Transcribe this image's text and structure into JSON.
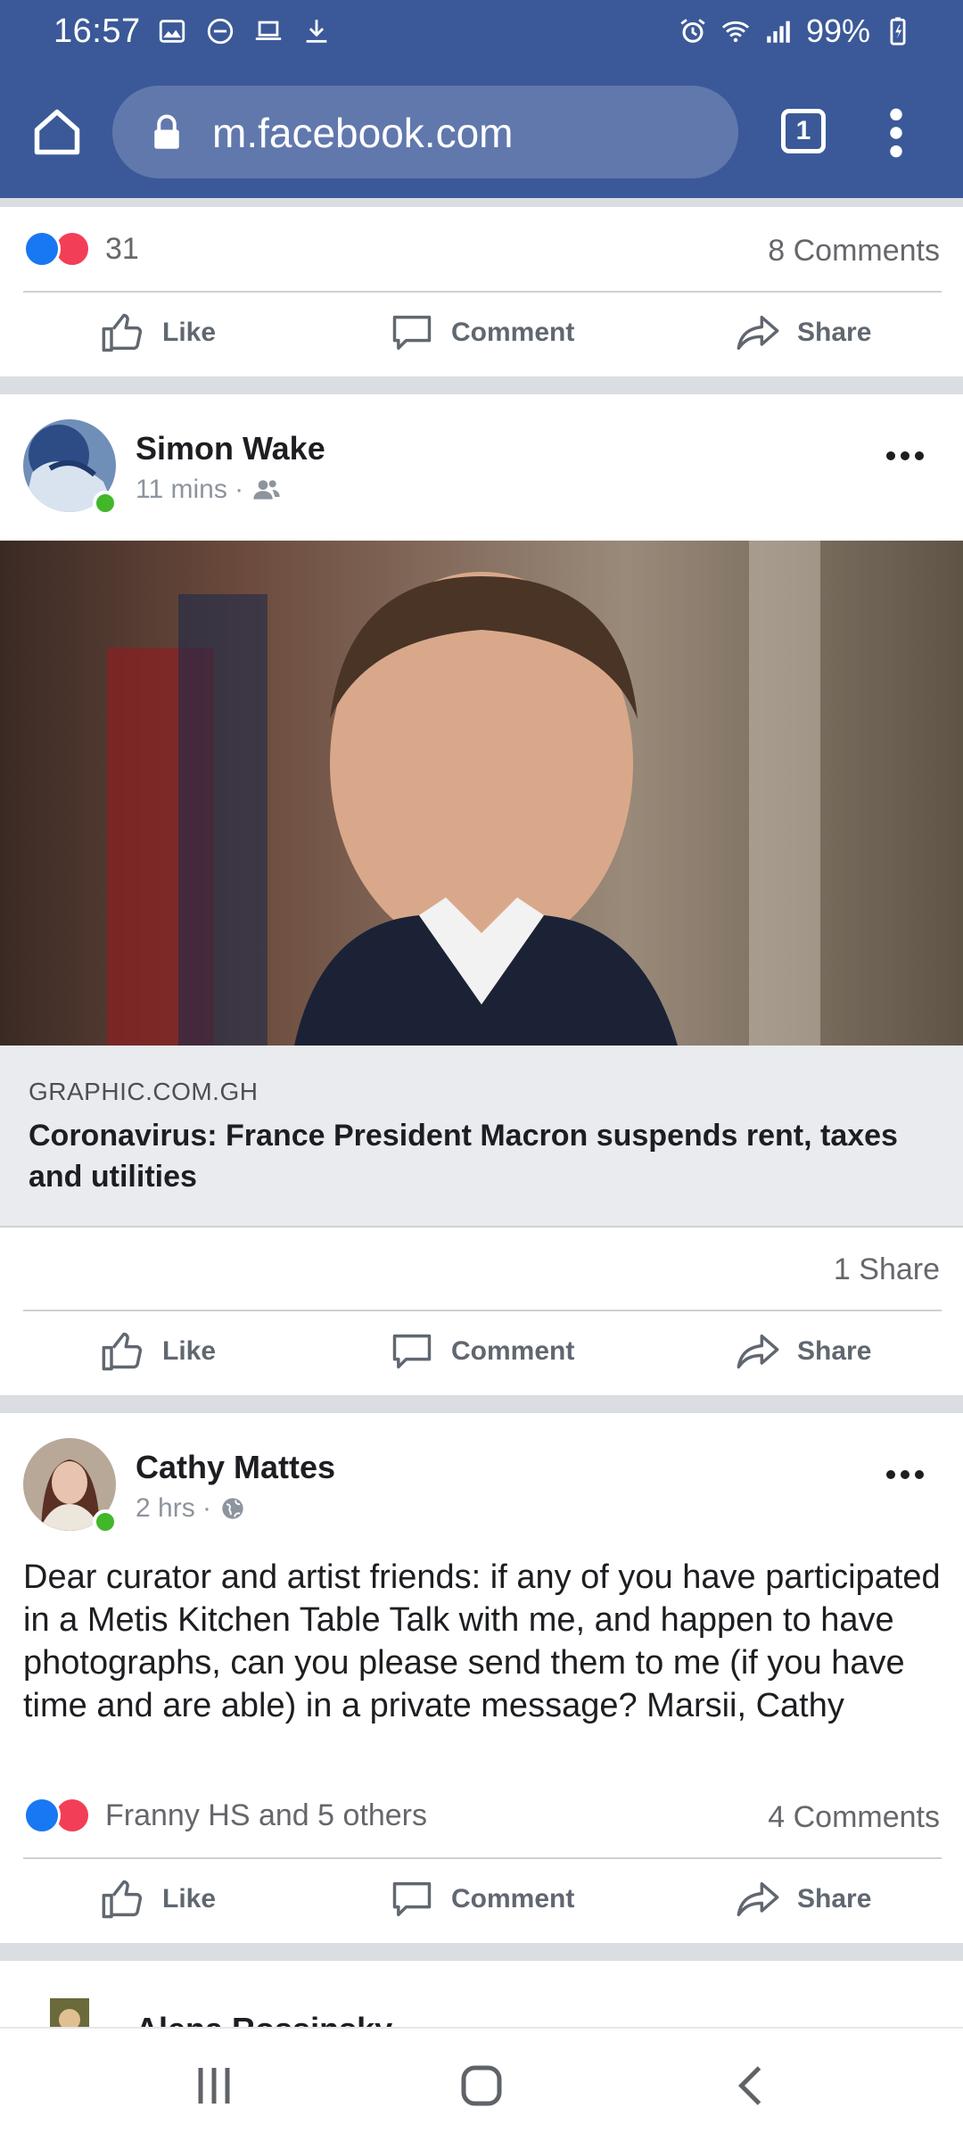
{
  "status_bar": {
    "time": "16:57",
    "battery": "99%",
    "left_icons": [
      "image-icon",
      "dnd-icon",
      "laptop-icon",
      "download-icon"
    ],
    "right_icons": [
      "alarm-icon",
      "wifi-icon",
      "signal-icon",
      "battery-icon"
    ]
  },
  "browser": {
    "url": "m.facebook.com",
    "tab_count": "1"
  },
  "colors": {
    "brand": "#3b5998",
    "like_blue": "#1877f2",
    "love_red": "#f33e58",
    "online_green": "#42b72a"
  },
  "prev_post": {
    "reaction_count": "31",
    "comments": "8 Comments"
  },
  "actions": {
    "like": "Like",
    "comment": "Comment",
    "share": "Share"
  },
  "post1": {
    "author": "Simon Wake",
    "time": "11 mins · ",
    "audience_icon": "friends-icon",
    "link_domain": "GRAPHIC.COM.GH",
    "link_title": "Coronavirus: France President Macron suspends rent, taxes and utilities",
    "shares": "1 Share"
  },
  "post2": {
    "author": "Cathy Mattes",
    "time": "2 hrs · ",
    "audience_icon": "globe-icon",
    "text": "Dear curator and artist friends: if any of you have participated in a Metis Kitchen Table Talk with me, and happen to have photographs, can you please send them to me (if you have time and are able) in a private message? Marsii, Cathy",
    "reaction_names": "Franny HS and 5 others",
    "comments": "4 Comments"
  },
  "post3": {
    "author": "Alena Rossinsky"
  },
  "navbar": {
    "icons": [
      "recents-icon",
      "home-nav-icon",
      "back-icon"
    ]
  }
}
